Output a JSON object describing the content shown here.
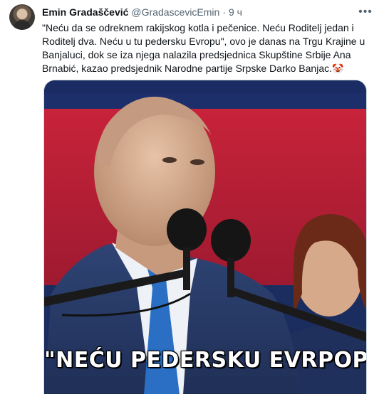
{
  "author": {
    "display_name": "Emin Gradaščević",
    "handle": "@GradascevicEmin",
    "separator": "·",
    "time": "9 ч",
    "more_icon": "more-horizontal-icon"
  },
  "tweet": {
    "text": "\"Neću da se odreknem rakijskog kotla i pečenice. Neću Roditelj jedan i Roditelj dva. Neću u tu pedersku Evropu\", ovo je danas na Trgu Krajine u Banjaluci, dok se iza njega nalazila predsjednica Skupštine Srbije Ana Brnabić, kazao predsjednik Narodne partije Srpske Darko Banjac.",
    "emoji": "🤡"
  },
  "media": {
    "caption": "\"NEĆU PEDERSKU EVRPOPU\""
  }
}
